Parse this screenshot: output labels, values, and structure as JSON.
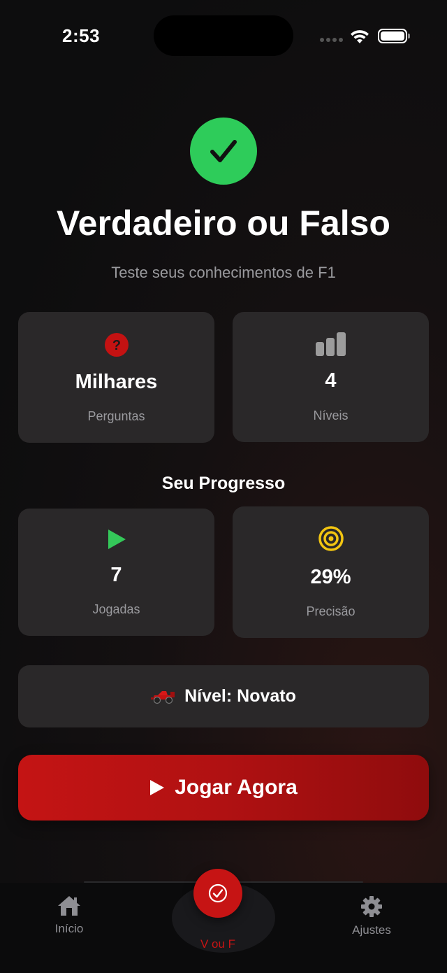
{
  "status_bar": {
    "time": "2:53"
  },
  "hero": {
    "title": "Verdadeiro ou Falso",
    "subtitle": "Teste seus conhecimentos de F1",
    "icon": "checkmark-circle-icon"
  },
  "stats": [
    {
      "icon": "question-circle-icon",
      "value": "Milhares",
      "label": "Perguntas"
    },
    {
      "icon": "bar-chart-icon",
      "value": "4",
      "label": "Níveis"
    }
  ],
  "progress": {
    "title": "Seu Progresso",
    "items": [
      {
        "icon": "play-icon",
        "value": "7",
        "label": "Jogadas"
      },
      {
        "icon": "target-icon",
        "value": "29%",
        "label": "Precisão"
      }
    ]
  },
  "level": {
    "icon": "race-car-icon",
    "text": "Nível: Novato"
  },
  "play_button": {
    "label": "Jogar Agora"
  },
  "tab_bar": {
    "items": [
      {
        "label": "Início",
        "icon": "home-icon"
      },
      {
        "label": "V ou F",
        "icon": "check-circle-icon",
        "active": true
      },
      {
        "label": "Ajustes",
        "icon": "gear-icon"
      }
    ]
  },
  "colors": {
    "accent_red": "#c61414",
    "success_green": "#2ecc5a",
    "target_yellow": "#f2c511",
    "card_bg": "#2a2829"
  }
}
